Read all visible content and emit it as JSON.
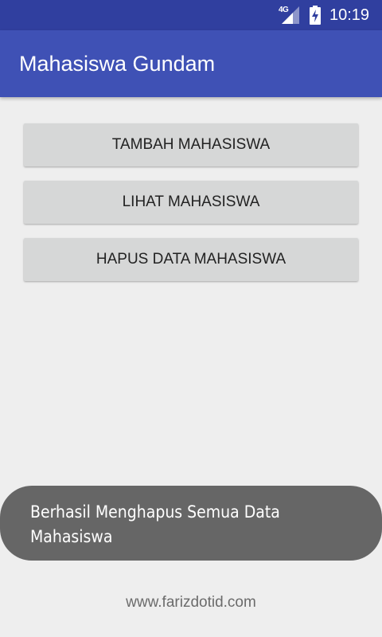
{
  "status_bar": {
    "network_label": "4G",
    "time": "10:19",
    "icons": [
      "signal-icon",
      "battery-charging-icon"
    ]
  },
  "app_bar": {
    "title": "Mahasiswa Gundam",
    "color": "#3f51b5",
    "status_color": "#303f9f"
  },
  "buttons": [
    {
      "label": "TAMBAH MAHASISWA"
    },
    {
      "label": "LIHAT MAHASISWA"
    },
    {
      "label": "HAPUS DATA MAHASISWA"
    }
  ],
  "toast": {
    "line1": "Berhasil Menghapus Semua Data",
    "line2": "Mahasiswa"
  },
  "footer": {
    "text": "www.farizdotid.com"
  }
}
